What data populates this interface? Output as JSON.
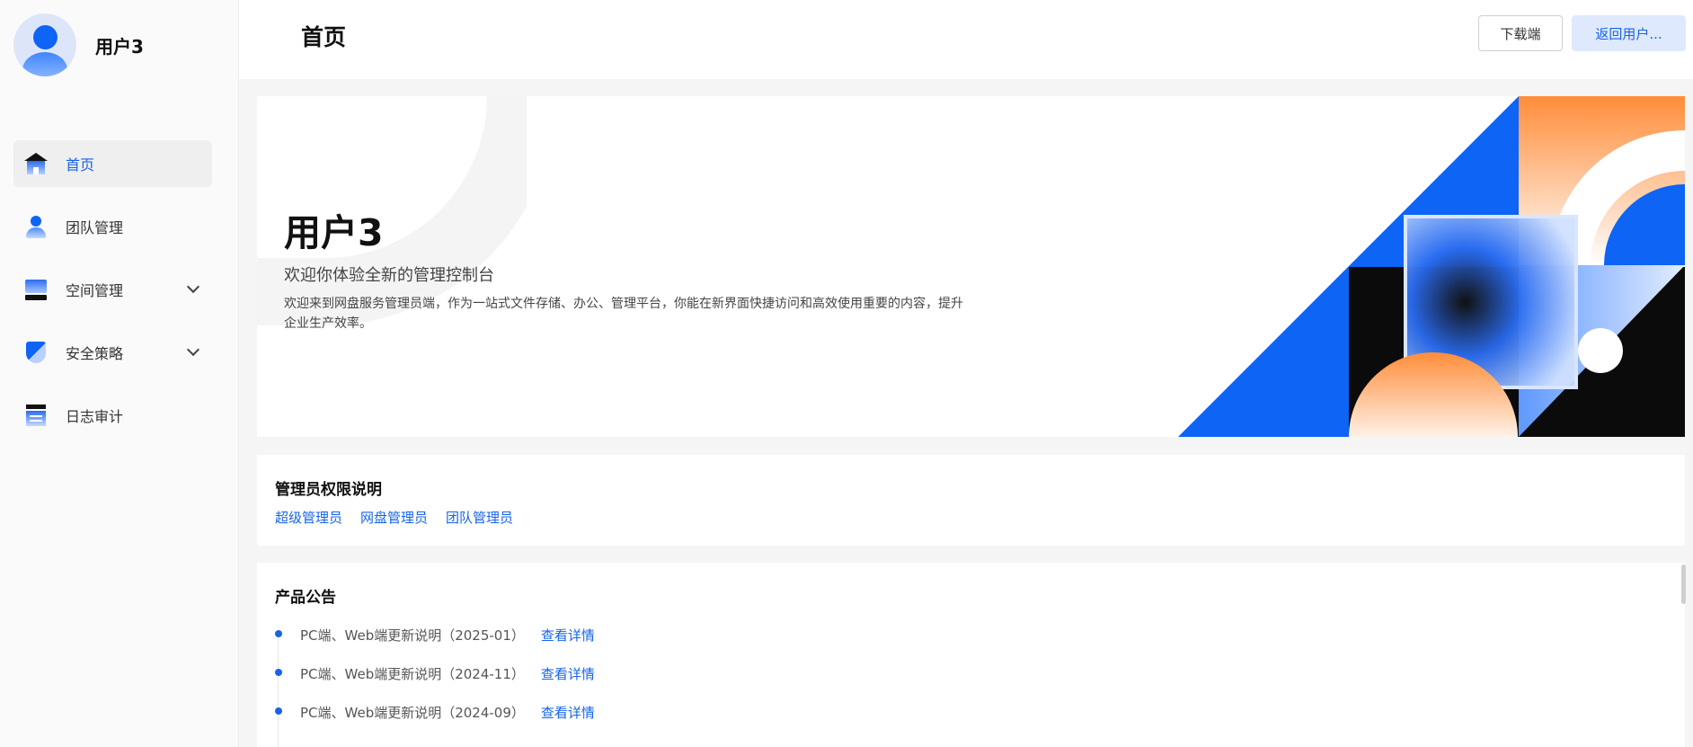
{
  "user": {
    "name": "用户3"
  },
  "sidebar": {
    "items": [
      {
        "label": "首页",
        "icon": "home-icon",
        "active": true
      },
      {
        "label": "团队管理",
        "icon": "team-icon"
      },
      {
        "label": "空间管理",
        "icon": "space-icon",
        "expandable": true
      },
      {
        "label": "安全策略",
        "icon": "security-icon",
        "expandable": true
      },
      {
        "label": "日志审计",
        "icon": "log-icon"
      }
    ]
  },
  "header": {
    "title": "首页",
    "download_label": "下载端",
    "return_label": "返回用户..."
  },
  "banner": {
    "name": "用户3",
    "subtitle": "欢迎你体验全新的管理控制台",
    "description": "欢迎来到网盘服务管理员端，作为一站式文件存储、办公、管理平台，你能在新界面快捷访问和高效使用重要的内容，提升企业生产效率。"
  },
  "permissions": {
    "title": "管理员权限说明",
    "links": [
      "超级管理员",
      "网盘管理员",
      "团队管理员"
    ]
  },
  "announcements": {
    "title": "产品公告",
    "items": [
      {
        "text": "PC端、Web端更新说明（2025-01）",
        "link": "查看详情"
      },
      {
        "text": "PC端、Web端更新说明（2024-11）",
        "link": "查看详情"
      },
      {
        "text": "PC端、Web端更新说明（2024-09）",
        "link": "查看详情"
      }
    ]
  },
  "colors": {
    "accent": "#1664e8",
    "banner_blue": "#0d64f5",
    "banner_orange": "#ff8d3a"
  }
}
